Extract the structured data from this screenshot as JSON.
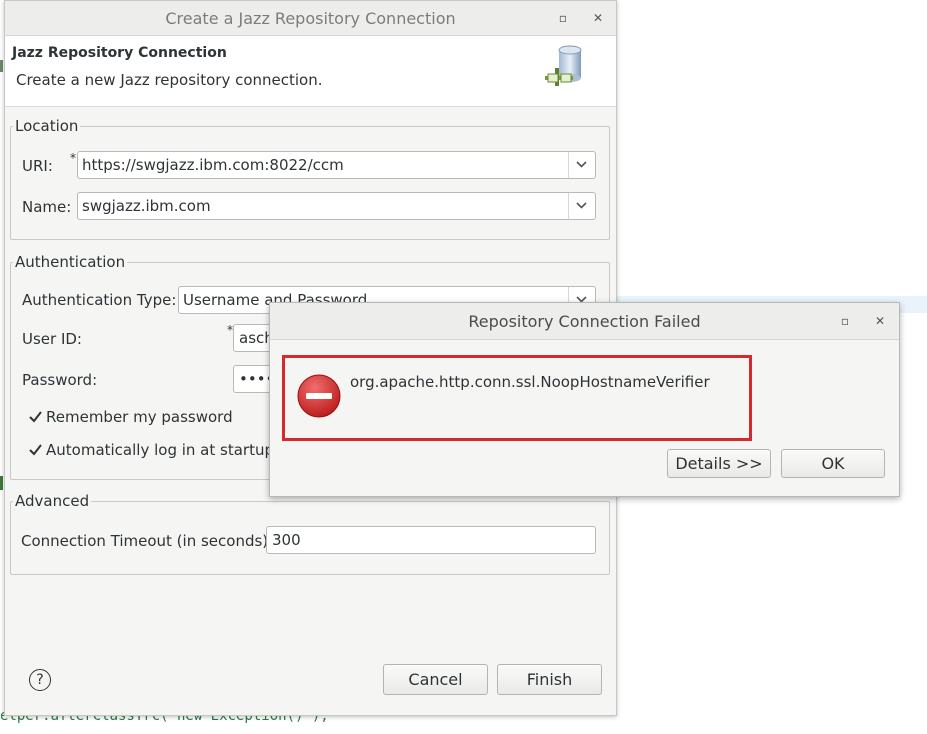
{
  "editor": {
    "code_line": "elper.afterClassTrc( new Exception() );"
  },
  "main_dialog": {
    "title": "Create a Jazz Repository Connection",
    "banner": {
      "title": "Jazz Repository Connection",
      "description": "Create a new Jazz repository connection.",
      "icon": "database-connection-icon"
    },
    "location": {
      "legend": "Location",
      "uri_label": "URI:",
      "uri_required": "*",
      "uri_value": "https://swgjazz.ibm.com:8022/ccm",
      "name_label": "Name:",
      "name_value": "swgjazz.ibm.com"
    },
    "authentication": {
      "legend": "Authentication",
      "type_label": "Authentication Type:",
      "type_value": "Username and Password",
      "user_label": "User ID:",
      "user_required": "*",
      "user_value": "asch",
      "password_label": "Password:",
      "password_value": "•••••",
      "remember_label": "Remember my password",
      "remember_checked": true,
      "autologin_label": "Automatically log in at startup",
      "autologin_checked": true
    },
    "advanced": {
      "legend": "Advanced",
      "timeout_label": "Connection Timeout (in seconds):",
      "timeout_value": "300"
    },
    "buttons": {
      "help": "?",
      "cancel": "Cancel",
      "finish": "Finish"
    }
  },
  "error_dialog": {
    "title": "Repository Connection Failed",
    "message": "org.apache.http.conn.ssl.NoopHostnameVerifier",
    "details_button": "Details >>",
    "ok_button": "OK",
    "icon": "error-stop-icon",
    "highlight_color": "#d7282f"
  },
  "window_controls": {
    "maximize": "▫",
    "close": "✕"
  }
}
